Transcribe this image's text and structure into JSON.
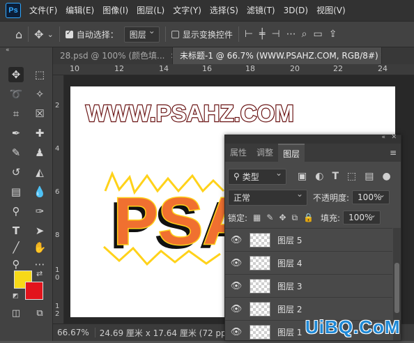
{
  "app": {
    "logo": "Ps"
  },
  "menu": [
    "文件(F)",
    "编辑(E)",
    "图像(I)",
    "图层(L)",
    "文字(Y)",
    "选择(S)",
    "滤镜(T)",
    "3D(D)",
    "视图(V)"
  ],
  "options": {
    "auto_select_label": "自动选择：",
    "auto_select_value": "图层",
    "show_transform_label": "显示变换控件"
  },
  "tabs": [
    {
      "label": "28.psd @ 100% (颜色填..."
    },
    {
      "label": "未标题-1 @ 66.7% (WWW.PSAHZ.COM, RGB/8#) *"
    }
  ],
  "ruler": {
    "h": [
      "10",
      "12",
      "14",
      "16",
      "18",
      "20",
      "22",
      "24"
    ],
    "v": [
      "2",
      "4",
      "6",
      "8",
      "1\n0",
      "1\n2",
      "1\n4",
      "1\n6"
    ]
  },
  "canvas": {
    "headline": "WWW.PSAHZ.COM",
    "art_text": "PSAHZ"
  },
  "status": {
    "zoom": "66.67%",
    "doc_size": "24.69 厘米 x 17.64 厘米 (72 ppi)"
  },
  "colors": {
    "foreground": "#f7d918",
    "background": "#e2141c"
  },
  "panel": {
    "tabs": [
      "属性",
      "调整",
      "图层"
    ],
    "filter_label": "类型",
    "blend_mode": "正常",
    "opacity_label": "不透明度:",
    "opacity_value": "100%",
    "lock_label": "锁定:",
    "fill_label": "填充:",
    "fill_value": "100%",
    "layers": [
      {
        "name": "图层",
        "num": "5"
      },
      {
        "name": "图层",
        "num": "4"
      },
      {
        "name": "图层",
        "num": "3"
      },
      {
        "name": "图层",
        "num": "2"
      },
      {
        "name": "图层",
        "num": "1"
      }
    ]
  },
  "watermark": "UiBQ.CoM"
}
